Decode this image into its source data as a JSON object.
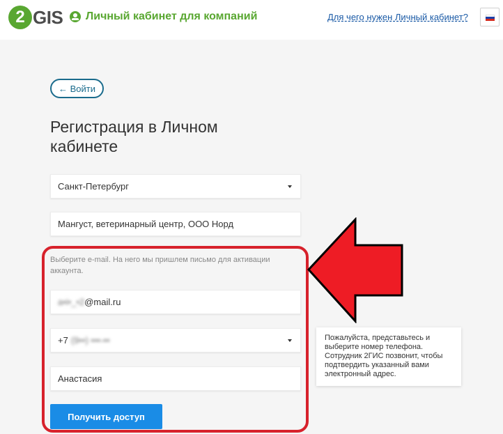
{
  "header": {
    "logo_text": "GIS",
    "logo_number": "2",
    "cabinet_title": "Личный кабинет для компаний",
    "why_link": "Для чего нужен Личный кабинет?",
    "lang_flag": "russia-flag-icon"
  },
  "back_button": "← Войти",
  "page_title": "Регистрация в Личном кабинете",
  "form": {
    "city_value": "Санкт-Петербург",
    "company_value": "Мангуст, ветеринарный центр, ООО Норд",
    "email_hint": "Выберите e-mail. На него мы пришлем письмо для активации аккаунта.",
    "email_visible": "@mail.ru",
    "phone_prefix": "+7",
    "name_value": "Анастасия",
    "submit_label": "Получить доступ"
  },
  "tooltip": "Пожалуйста, представьтесь и выберите номер телефона. Сотрудник 2ГИС позвонит, чтобы подтвердить указанный вами электронный адрес.",
  "colors": {
    "brand_green": "#59a731",
    "link_blue": "#1a5aa6",
    "button_blue": "#1a8ce6",
    "annotation_red": "#d7222c"
  }
}
